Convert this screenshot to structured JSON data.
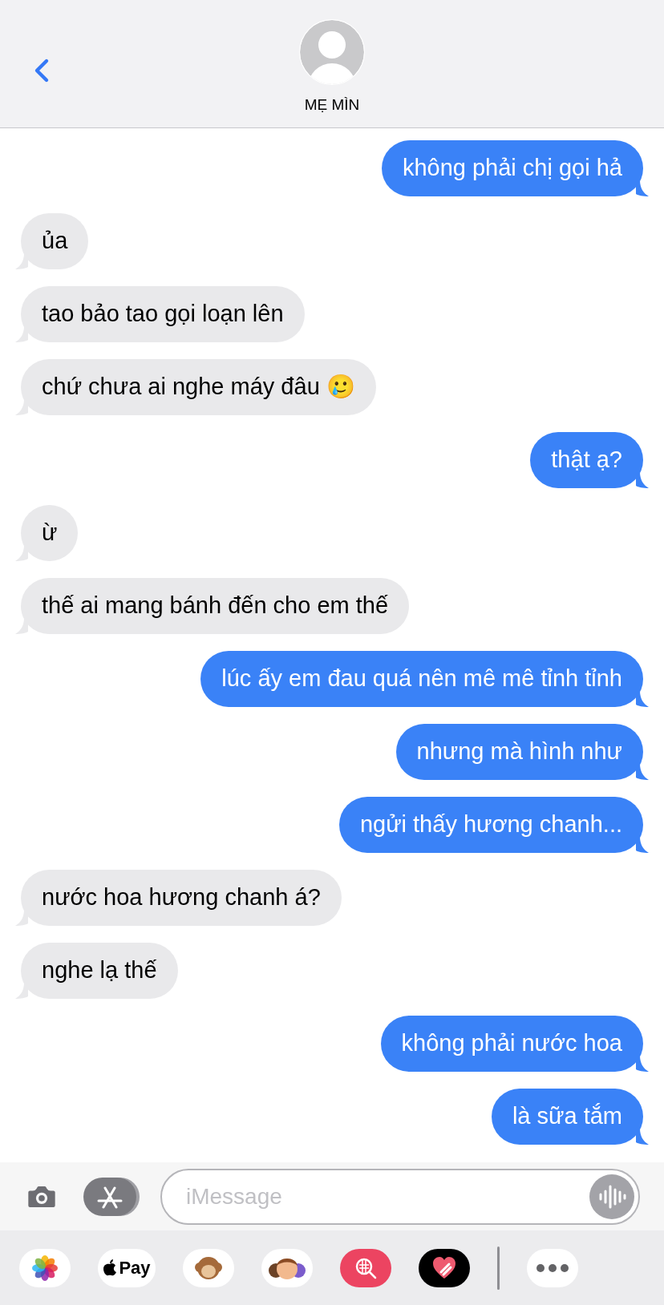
{
  "header": {
    "contact_name": "MẸ MÌN"
  },
  "messages": [
    {
      "text": "không phải chị gọi hả",
      "sent": true
    },
    {
      "text": "ủa",
      "sent": false
    },
    {
      "text": "tao bảo tao gọi loạn lên",
      "sent": false
    },
    {
      "text": "chứ chưa ai nghe máy đâu 🥲",
      "sent": false
    },
    {
      "text": "thật ạ?",
      "sent": true
    },
    {
      "text": "ừ",
      "sent": false
    },
    {
      "text": "thế ai mang bánh đến cho em thế",
      "sent": false
    },
    {
      "text": "lúc ấy em đau quá nên mê mê tỉnh tỉnh",
      "sent": true
    },
    {
      "text": "nhưng mà hình như",
      "sent": true
    },
    {
      "text": "ngửi thấy hương chanh...",
      "sent": true
    },
    {
      "text": "nước hoa hương chanh á?",
      "sent": false
    },
    {
      "text": "nghe lạ thế",
      "sent": false
    },
    {
      "text": "không phải nước hoa",
      "sent": true
    },
    {
      "text": "là sữa tắm",
      "sent": true
    }
  ],
  "composer": {
    "placeholder": "iMessage"
  },
  "app_strip": [
    {
      "kind": "photos"
    },
    {
      "kind": "pay",
      "label": "Pay"
    },
    {
      "kind": "animoji"
    },
    {
      "kind": "memoji"
    },
    {
      "kind": "search"
    },
    {
      "kind": "heart"
    },
    {
      "kind": "divider"
    },
    {
      "kind": "more"
    }
  ]
}
